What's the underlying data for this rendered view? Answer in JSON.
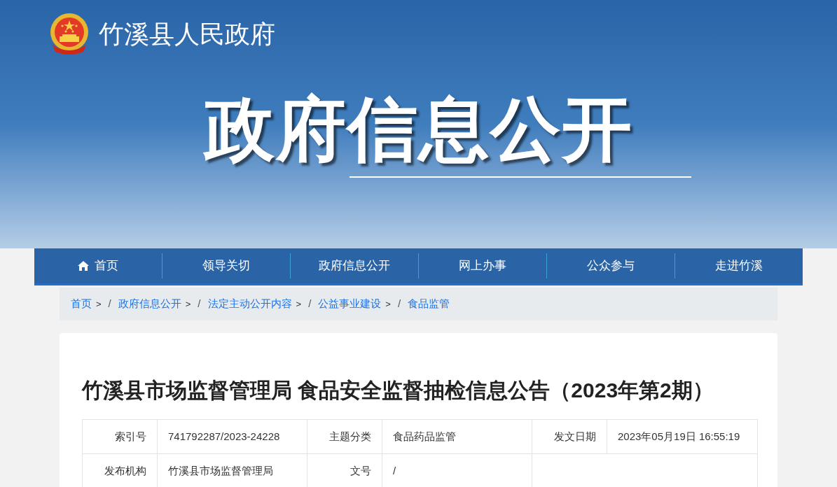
{
  "site": {
    "name": "竹溪县人民政府"
  },
  "banner": {
    "title": "政府信息公开"
  },
  "nav": [
    {
      "label": "首页",
      "kind": "home",
      "selected": false
    },
    {
      "label": "领导关切",
      "kind": "plain",
      "selected": false
    },
    {
      "label": "政府信息公开",
      "kind": "plain",
      "selected": false
    },
    {
      "label": "网上办事",
      "kind": "plain",
      "selected": false
    },
    {
      "label": "公众参与",
      "kind": "plain",
      "selected": false
    },
    {
      "label": "走进竹溪",
      "kind": "plain",
      "selected": false
    }
  ],
  "breadcrumb": {
    "divider": "/",
    "items": [
      {
        "label": "首页",
        "arrow": ">"
      },
      {
        "label": "政府信息公开",
        "arrow": ">"
      },
      {
        "label": "法定主动公开内容",
        "arrow": ">"
      },
      {
        "label": "公益事业建设",
        "arrow": ">"
      },
      {
        "label": "食品监管"
      }
    ]
  },
  "article": {
    "title": "竹溪县市场监督管理局 食品安全监督抽检信息公告（2023年第2期）",
    "meta": [
      [
        {
          "label": "索引号",
          "value": "741792287/2023-24228"
        },
        {
          "label": "主题分类",
          "value": "食品药品监管"
        },
        {
          "label": "发文日期",
          "value": "2023年05月19日 16:55:19"
        }
      ],
      [
        {
          "label": "发布机构",
          "value": "竹溪县市场监督管理局"
        },
        {
          "label": "文号",
          "value": "/"
        }
      ]
    ]
  }
}
